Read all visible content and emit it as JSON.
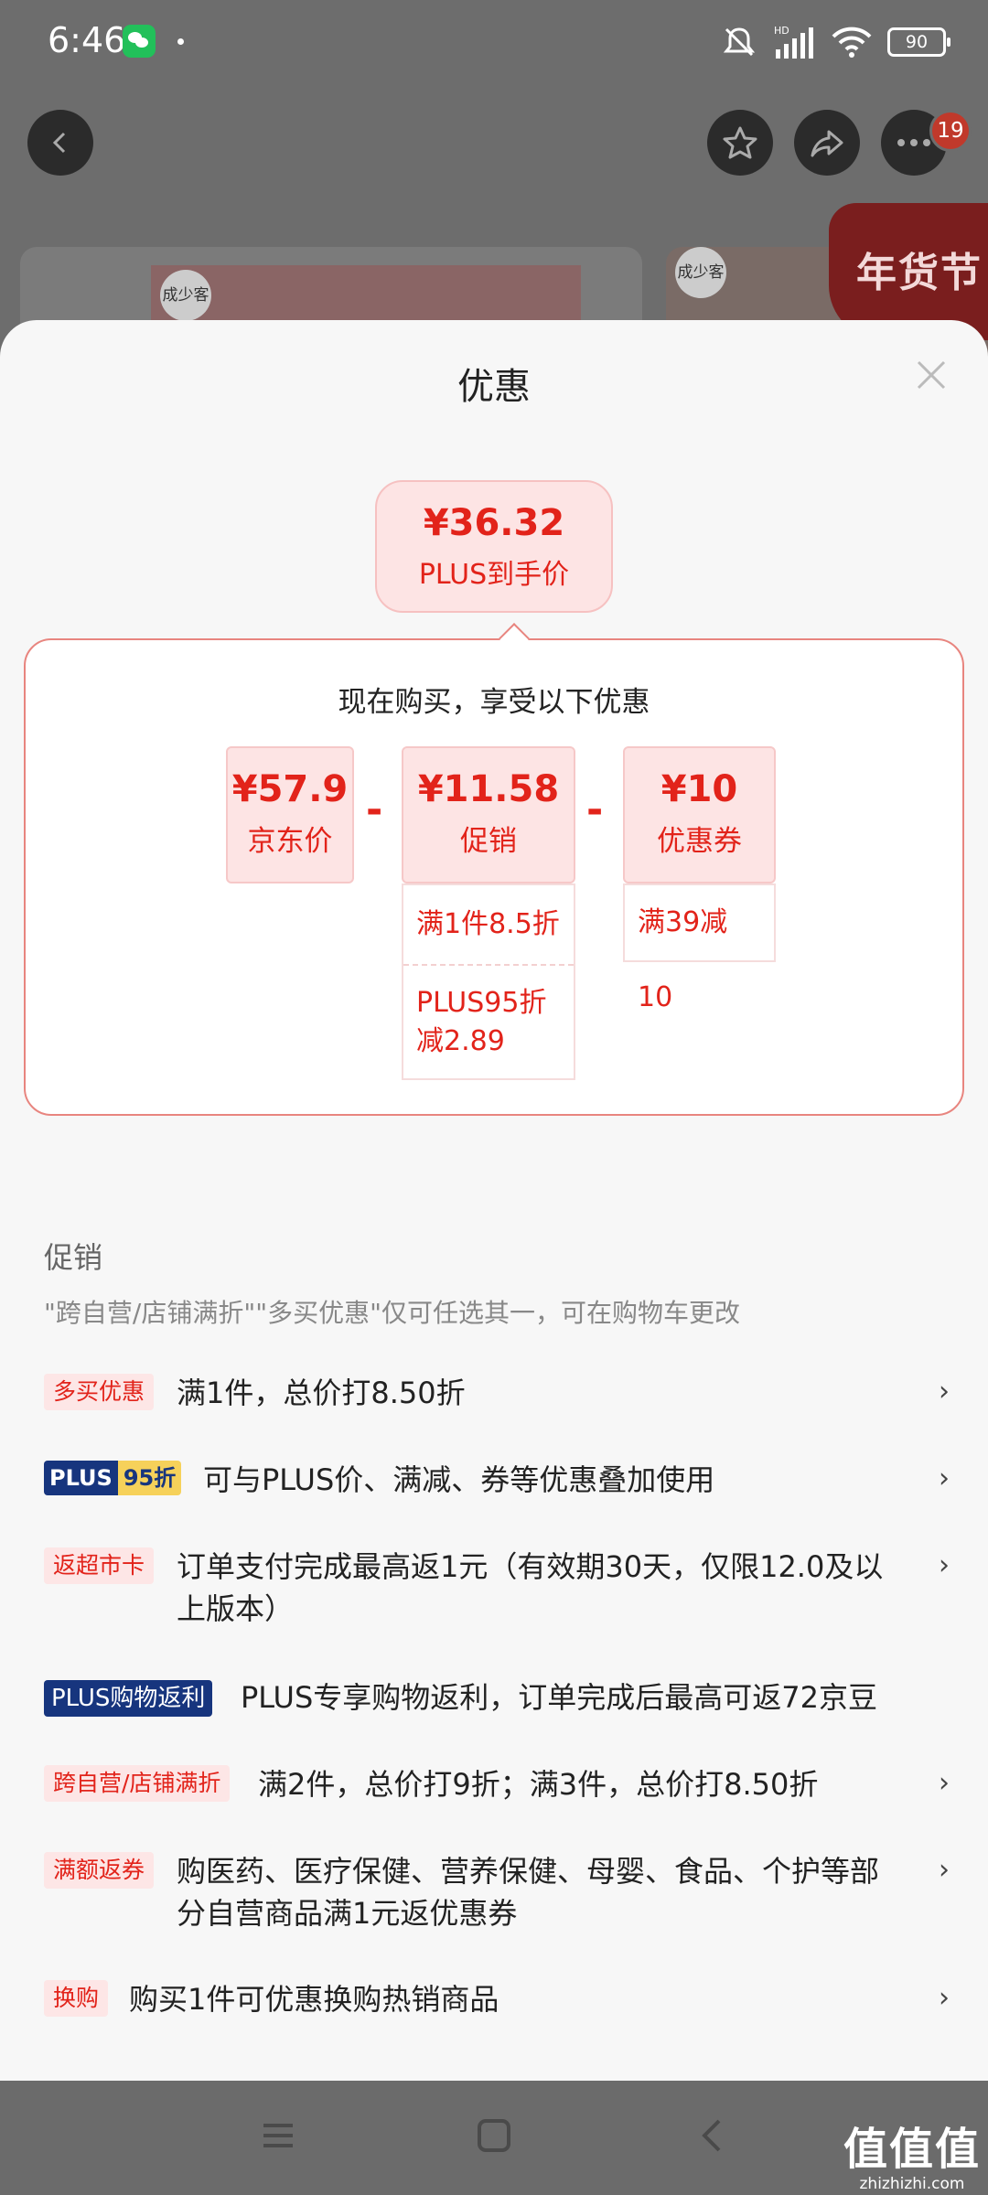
{
  "status_bar": {
    "time": "6:46",
    "battery": "90",
    "icons": [
      "mute-icon",
      "hd-signal-icon",
      "wifi-icon",
      "battery-icon"
    ]
  },
  "top_bar": {
    "notification_count": "19",
    "icons": [
      "back-icon",
      "favorite-star-icon",
      "share-icon",
      "more-icon"
    ]
  },
  "background": {
    "banner_text": "年货节",
    "logo_text": "成少客"
  },
  "sheet": {
    "title": "优惠",
    "final_price": {
      "value": "¥36.32",
      "label": "PLUS到手价"
    },
    "breakdown": {
      "title": "现在购买，享受以下优惠",
      "items": [
        {
          "value": "¥57.9",
          "label": "京东价"
        },
        {
          "value": "¥11.58",
          "label": "促销",
          "details": [
            "满1件8.5折",
            "PLUS95折\n减2.89"
          ]
        },
        {
          "value": "¥10",
          "label": "优惠券",
          "details": [
            "满39减10"
          ]
        }
      ],
      "operator": "-"
    },
    "promotions": {
      "heading": "促销",
      "note": "\"跨自营/店铺满折\"\"多买优惠\"仅可任选其一，可在购物车更改",
      "items": [
        {
          "tag": "多买优惠",
          "text": "满1件，总价打8.50折"
        },
        {
          "tag_a": "PLUS",
          "tag_b": "95折",
          "text": "可与PLUS价、满减、券等优惠叠加使用"
        },
        {
          "tag": "返超市卡",
          "text": "订单支付完成最高返1元（有效期30天，仅限12.0及以上版本）"
        },
        {
          "tag": "PLUS购物返利",
          "text": "PLUS专享购物返利，订单完成后最高可返72京豆"
        },
        {
          "tag": "跨自营/店铺满折",
          "text": "满2件，总价打9折；满3件，总价打8.50折"
        },
        {
          "tag": "满额返券",
          "text": "购医药、医疗保健、营养保健、母婴、食品、个护等部分自营商品满1元返优惠券"
        },
        {
          "tag": "换购",
          "text": "购买1件可优惠换购热销商品"
        }
      ],
      "chevron": "›"
    }
  },
  "watermark": {
    "main": "值值值",
    "url": "zhizhizhi.com"
  },
  "colors": {
    "accent_red": "#e2231a",
    "tag_bg": "#fde6e6",
    "plus_navy": "#17357e",
    "plus_gold": "#f6d15a"
  }
}
